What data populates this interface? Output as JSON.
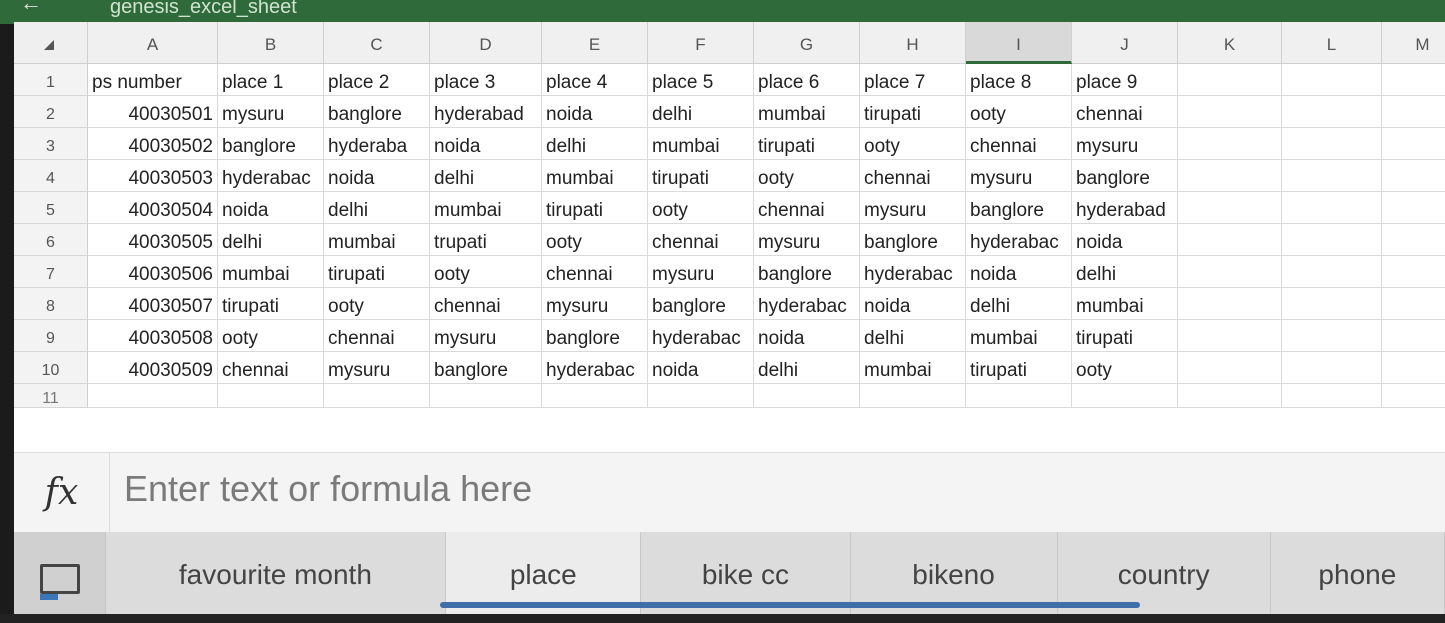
{
  "window": {
    "title": "genesis_excel_sheet"
  },
  "columns": [
    "A",
    "B",
    "C",
    "D",
    "E",
    "F",
    "G",
    "H",
    "I",
    "J",
    "K",
    "L",
    "M"
  ],
  "selected_column": "I",
  "rows": [
    "1",
    "2",
    "3",
    "4",
    "5",
    "6",
    "7",
    "8",
    "9",
    "10",
    "11"
  ],
  "table": [
    [
      "ps number",
      "place 1",
      "place 2",
      "place 3",
      "place 4",
      "place 5",
      "place 6",
      "place 7",
      "place 8",
      "place 9",
      "",
      "",
      ""
    ],
    [
      "40030501",
      "mysuru",
      "banglore",
      "hyderabad",
      "noida",
      "delhi",
      "mumbai",
      "tirupati",
      "ooty",
      "chennai",
      "",
      "",
      ""
    ],
    [
      "40030502",
      "banglore",
      "hyderaba",
      "noida",
      "delhi",
      "mumbai",
      "tirupati",
      "ooty",
      "chennai",
      "mysuru",
      "",
      "",
      ""
    ],
    [
      "40030503",
      "hyderabac",
      "noida",
      "delhi",
      "mumbai",
      "tirupati",
      "ooty",
      "chennai",
      "mysuru",
      "banglore",
      "",
      "",
      ""
    ],
    [
      "40030504",
      "noida",
      "delhi",
      "mumbai",
      "tirupati",
      "ooty",
      "chennai",
      "mysuru",
      "banglore",
      "hyderabad",
      "",
      "",
      ""
    ],
    [
      "40030505",
      "delhi",
      "mumbai",
      "trupati",
      "ooty",
      "chennai",
      "mysuru",
      "banglore",
      "hyderabac",
      "noida",
      "",
      "",
      ""
    ],
    [
      "40030506",
      "mumbai",
      "tirupati",
      "ooty",
      "chennai",
      "mysuru",
      "banglore",
      "hyderabac",
      "noida",
      "delhi",
      "",
      "",
      ""
    ],
    [
      "40030507",
      "tirupati",
      "ooty",
      "chennai",
      "mysuru",
      "banglore",
      "hyderabac",
      "noida",
      "delhi",
      "mumbai",
      "",
      "",
      ""
    ],
    [
      "40030508",
      "ooty",
      "chennai",
      "mysuru",
      "banglore",
      "hyderabac",
      "noida",
      "delhi",
      "mumbai",
      "tirupati",
      "",
      "",
      ""
    ],
    [
      "40030509",
      "chennai",
      "mysuru",
      "banglore",
      "hyderabac",
      "noida",
      "delhi",
      "mumbai",
      "tirupati",
      "ooty",
      "",
      "",
      ""
    ],
    [
      "",
      "",
      "",
      "",
      "",
      "",
      "",
      "",
      "",
      "",
      "",
      "",
      ""
    ]
  ],
  "formula_bar": {
    "icon": "fx",
    "placeholder": "Enter text or formula here"
  },
  "sheet_tabs": [
    {
      "label": "favourite month"
    },
    {
      "label": "place"
    },
    {
      "label": "bike cc"
    },
    {
      "label": "bikeno"
    },
    {
      "label": "country"
    },
    {
      "label": "phone"
    }
  ],
  "active_tab": "place",
  "icons": {
    "corner": "select-all-icon",
    "sheets": "sheet-list-icon"
  }
}
